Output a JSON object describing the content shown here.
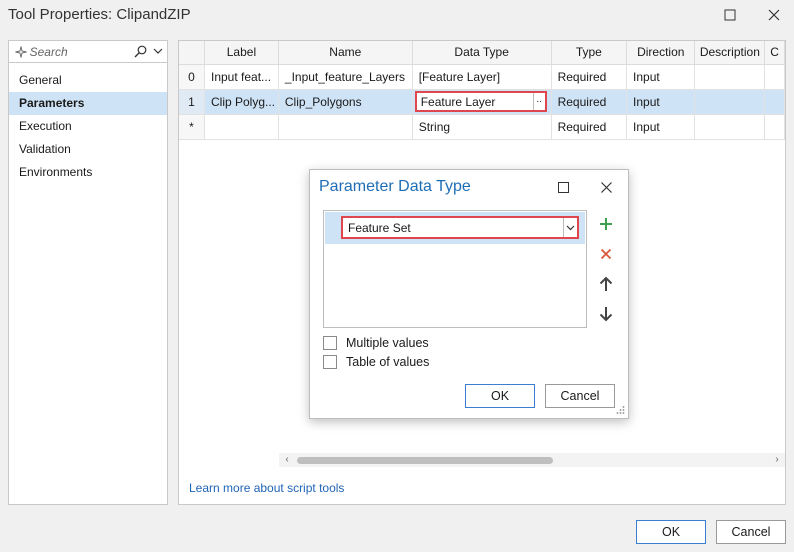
{
  "window": {
    "title": "Tool Properties: ClipandZIP"
  },
  "sidebar": {
    "search_placeholder": "Search",
    "items": [
      {
        "label": "General",
        "active": false
      },
      {
        "label": "Parameters",
        "active": true
      },
      {
        "label": "Execution",
        "active": false
      },
      {
        "label": "Validation",
        "active": false
      },
      {
        "label": "Environments",
        "active": false
      }
    ]
  },
  "parameters_table": {
    "columns": [
      "",
      "Label",
      "Name",
      "Data Type",
      "Type",
      "Direction",
      "Description",
      "C"
    ],
    "rows": [
      {
        "index": "0",
        "label": "Input feat...",
        "name": "_Input_feature_Layers",
        "data_type": "[Feature Layer]",
        "type": "Required",
        "direction": "Input",
        "description": "",
        "extra": ""
      },
      {
        "index": "1",
        "label": "Clip Polyg...",
        "name": "Clip_Polygons",
        "data_type": "Feature Layer",
        "type": "Required",
        "direction": "Input",
        "description": "",
        "extra": ""
      },
      {
        "index": "*",
        "label": "",
        "name": "",
        "data_type": "String",
        "type": "Required",
        "direction": "Input",
        "description": "",
        "extra": ""
      }
    ],
    "editor_button": ".."
  },
  "learn_link": "Learn more about script tools",
  "dialog": {
    "title": "Parameter Data Type",
    "selected_type": "Feature Set",
    "multiple_values_label": "Multiple values",
    "table_of_values_label": "Table of values",
    "ok_label": "OK",
    "cancel_label": "Cancel"
  },
  "footer": {
    "ok_label": "OK",
    "cancel_label": "Cancel"
  },
  "colors": {
    "accent": "#1f6eb5",
    "selection": "#cfe3f6",
    "highlight_border": "#e0474c",
    "add_icon": "#3aa34b",
    "remove_icon": "#d9583b",
    "link": "#1f64b5"
  }
}
